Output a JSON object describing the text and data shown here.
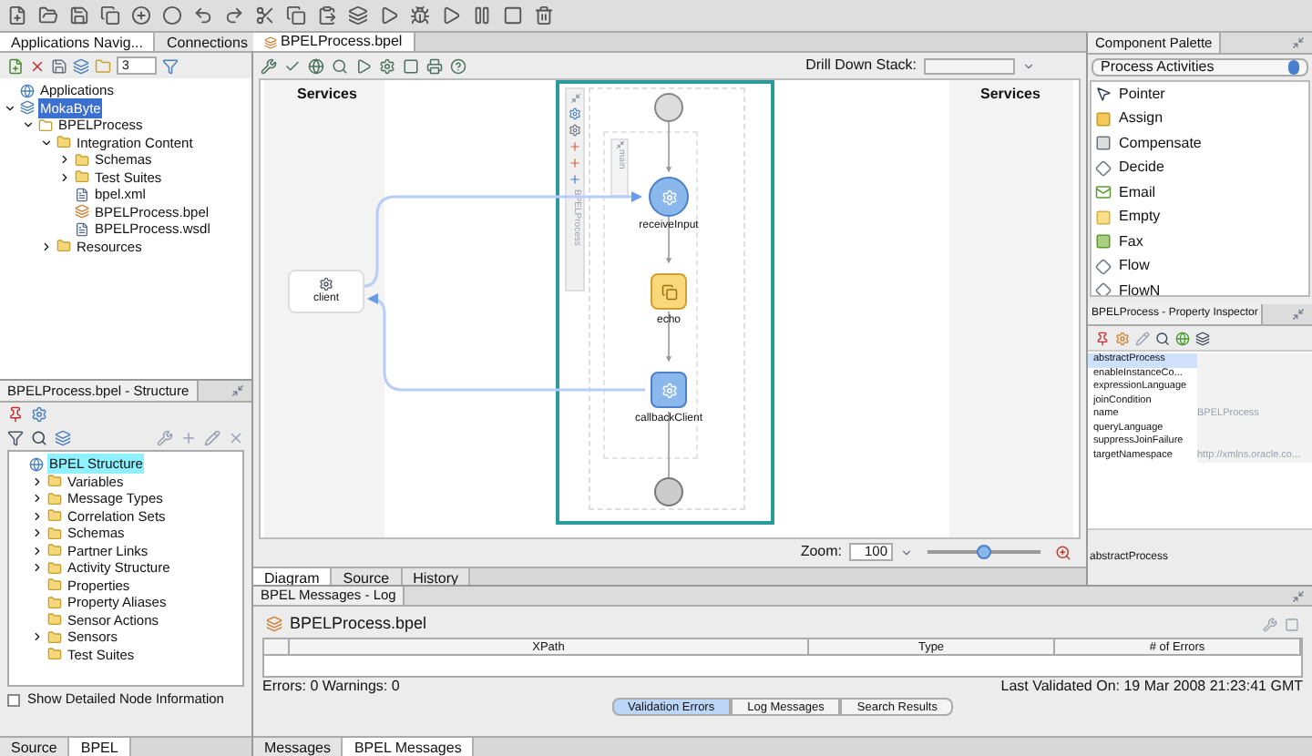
{
  "navigator": {
    "tabs": [
      {
        "label": "Applications Navig...",
        "selected": true
      },
      {
        "label": "Connections",
        "selected": false
      }
    ],
    "level_field": "3",
    "tree": [
      {
        "label": "Applications",
        "kind": "apps",
        "selected": false
      },
      {
        "label": "MokaByte",
        "kind": "app",
        "selected": true,
        "expanded": true,
        "children": [
          {
            "label": "BPELProcess",
            "kind": "project",
            "selected": false,
            "expanded": true,
            "children": [
              {
                "label": "Integration Content",
                "kind": "folder",
                "selected": false,
                "expanded": true,
                "children": [
                  {
                    "label": "Schemas",
                    "kind": "folder",
                    "selected": false,
                    "expanded": false
                  },
                  {
                    "label": "Test Suites",
                    "kind": "folder",
                    "selected": false,
                    "expanded": false
                  },
                  {
                    "label": "bpel.xml",
                    "kind": "file",
                    "selected": false
                  },
                  {
                    "label": "BPELProcess.bpel",
                    "kind": "bpel",
                    "selected": false
                  },
                  {
                    "label": "BPELProcess.wsdl",
                    "kind": "file",
                    "selected": false
                  }
                ]
              },
              {
                "label": "Resources",
                "kind": "folder",
                "selected": false,
                "expanded": false
              }
            ]
          }
        ]
      }
    ]
  },
  "structure": {
    "title": "BPELProcess.bpel - Structure",
    "tree": [
      {
        "label": "BPEL Structure",
        "kind": "globe",
        "selected": true,
        "children": [
          {
            "label": "Variables",
            "kind": "folder",
            "selected": false,
            "expanded": false
          },
          {
            "label": "Message Types",
            "kind": "folder",
            "selected": false,
            "expanded": false
          },
          {
            "label": "Correlation Sets",
            "kind": "folder",
            "selected": false,
            "expanded": false
          },
          {
            "label": "Schemas",
            "kind": "folder",
            "selected": false,
            "expanded": false
          },
          {
            "label": "Partner Links",
            "kind": "folder",
            "selected": false,
            "expanded": false
          },
          {
            "label": "Activity Structure",
            "kind": "folder",
            "selected": false,
            "expanded": false
          },
          {
            "label": "Properties",
            "kind": "folder",
            "selected": false
          },
          {
            "label": "Property Aliases",
            "kind": "folder",
            "selected": false
          },
          {
            "label": "Sensor Actions",
            "kind": "folder",
            "selected": false
          },
          {
            "label": "Sensors",
            "kind": "folder",
            "selected": false,
            "expanded": false
          },
          {
            "label": "Test Suites",
            "kind": "folder",
            "selected": false
          }
        ]
      }
    ],
    "detail_checkbox": {
      "label": "Show Detailed Node Information",
      "checked": false
    },
    "tabs": [
      {
        "label": "Source",
        "selected": false
      },
      {
        "label": "BPEL",
        "selected": true
      }
    ]
  },
  "editor": {
    "tab": "BPELProcess.bpel",
    "drill_down_label": "Drill Down Stack:",
    "lanes": [
      "Services",
      "Services"
    ],
    "process": {
      "label": "BPELProcess",
      "scope_label": "main"
    },
    "partner": {
      "label": "client"
    },
    "activities": [
      {
        "label": "receiveInput",
        "kind": "receive"
      },
      {
        "label": "echo",
        "kind": "assign"
      },
      {
        "label": "callbackClient",
        "kind": "invoke"
      }
    ],
    "zoom": {
      "label": "Zoom:",
      "value": "100",
      "level": 0.5
    },
    "view_tabs": [
      {
        "label": "Diagram",
        "selected": true
      },
      {
        "label": "Source",
        "selected": false
      },
      {
        "label": "History",
        "selected": false
      }
    ]
  },
  "palette": {
    "title": "Component Palette",
    "category": "Process Activities",
    "items": [
      {
        "label": "Pointer",
        "kind": "pointer"
      },
      {
        "label": "Assign",
        "kind": "assign"
      },
      {
        "label": "Compensate",
        "kind": "compensate"
      },
      {
        "label": "Decide",
        "kind": "decide"
      },
      {
        "label": "Email",
        "kind": "email"
      },
      {
        "label": "Empty",
        "kind": "empty"
      },
      {
        "label": "Fax",
        "kind": "fax"
      },
      {
        "label": "Flow",
        "kind": "flow"
      },
      {
        "label": "FlowN",
        "kind": "flow"
      }
    ]
  },
  "inspector": {
    "title": "BPELProcess - Property Inspector",
    "properties": [
      {
        "name": "abstractProcess",
        "selected": true
      },
      {
        "name": "enableInstanceCo...",
        "selected": false
      },
      {
        "name": "expressionLanguage",
        "selected": false
      },
      {
        "name": "joinCondition",
        "selected": false
      },
      {
        "name": "name",
        "value": "BPELProcess",
        "selected": false
      },
      {
        "name": "queryLanguage",
        "selected": false
      },
      {
        "name": "suppressJoinFailure",
        "selected": false
      },
      {
        "name": "targetNamespace",
        "value": "http://xmlns.oracle.co...",
        "selected": false
      }
    ],
    "description": "abstractProcess"
  },
  "log": {
    "title": "BPEL Messages - Log",
    "file": "BPELProcess.bpel",
    "columns": [
      "XPath",
      "Type",
      "# of Errors"
    ],
    "summary": "Errors: 0 Warnings: 0",
    "last_validated": "Last Validated On: 19 Mar 2008 21:23:41 GMT",
    "tabs": [
      {
        "label": "Validation Errors",
        "selected": true
      },
      {
        "label": "Log Messages",
        "selected": false
      },
      {
        "label": "Search Results",
        "selected": false
      }
    ]
  },
  "bottom_tabs": [
    {
      "label": "Messages",
      "selected": false
    },
    {
      "label": "BPEL Messages",
      "selected": true
    }
  ]
}
